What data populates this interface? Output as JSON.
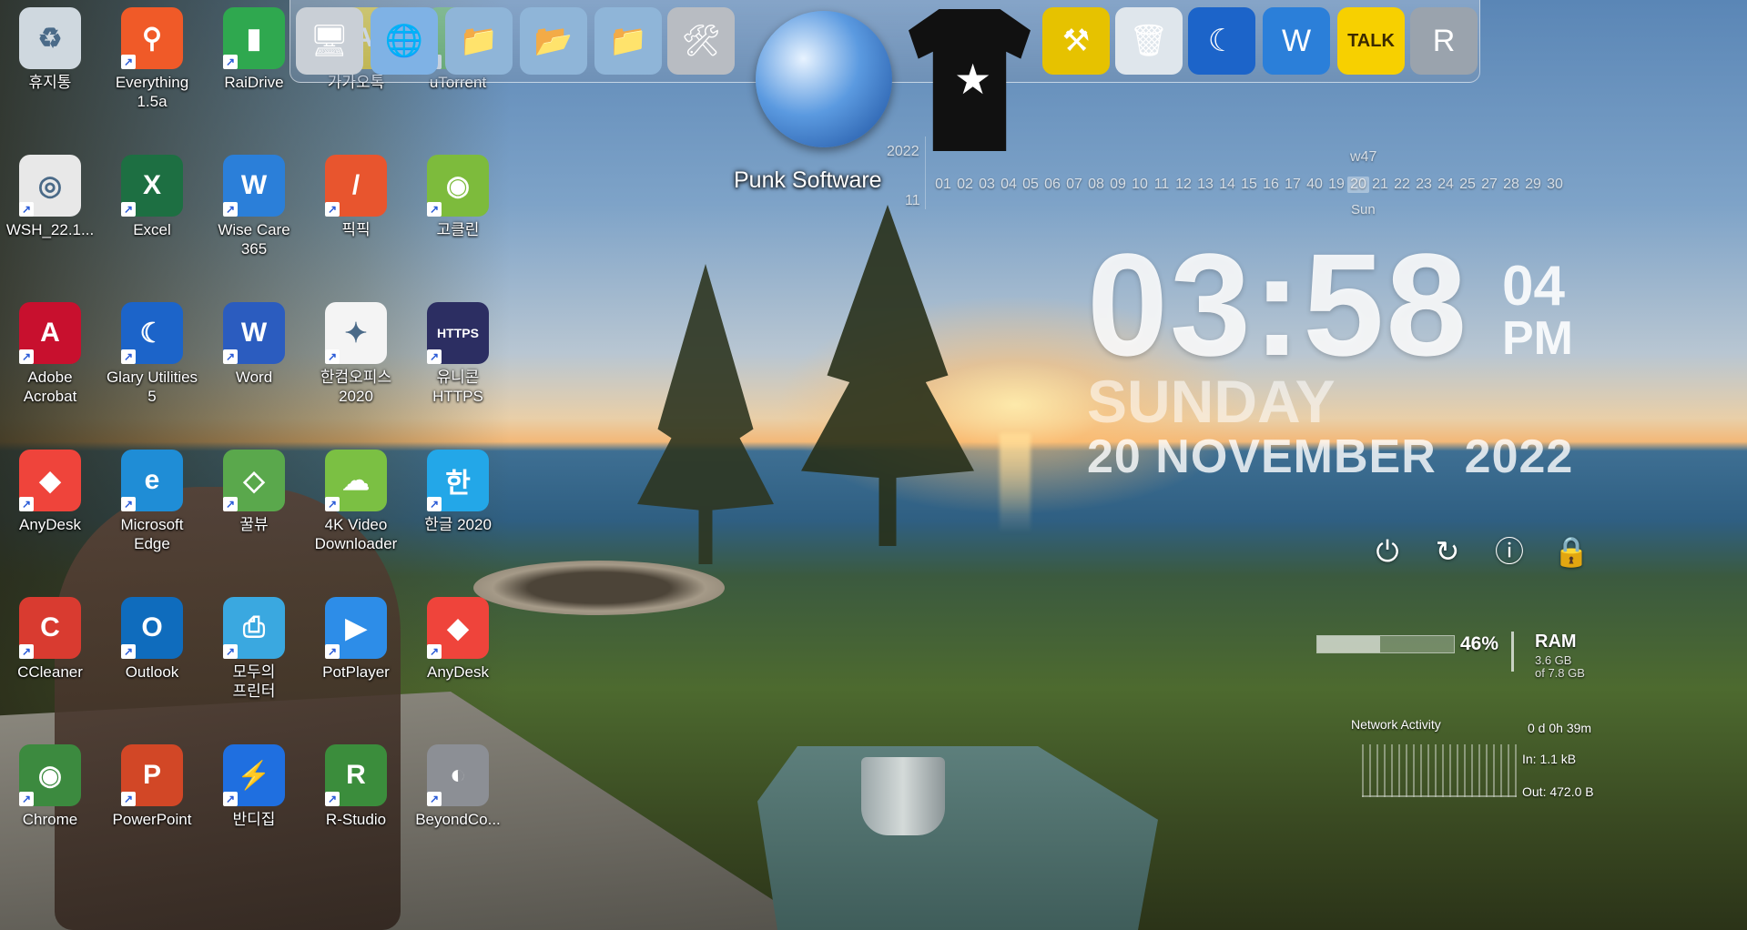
{
  "desktop_icons": [
    {
      "label": "휴지통",
      "icon": "recycle-bin-icon",
      "color": "#cfd8df"
    },
    {
      "label": "Everything\n1.5a",
      "icon": "search-magnifier-icon",
      "color": "#f05a28"
    },
    {
      "label": "RaiDrive",
      "icon": "raidrive-icon",
      "color": "#2fa84f"
    },
    {
      "label": "가가오톡",
      "icon": "kakaotalk-icon",
      "color": "#f7d000"
    },
    {
      "label": "uTorrent",
      "icon": "utorrent-icon",
      "color": "#58b947"
    },
    {
      "label": "WSH_22.1...",
      "icon": "cd-file-icon",
      "color": "#e8e8e8"
    },
    {
      "label": "Excel",
      "icon": "excel-icon",
      "color": "#1d6f42"
    },
    {
      "label": "Wise Care\n365",
      "icon": "wise-care-icon",
      "color": "#2b7fd9"
    },
    {
      "label": "픽픽",
      "icon": "picpick-icon",
      "color": "#e8552e"
    },
    {
      "label": "고클린",
      "icon": "goclean-icon",
      "color": "#7dbb3c"
    },
    {
      "label": "Adobe\nAcrobat",
      "icon": "acrobat-icon",
      "color": "#c8102e"
    },
    {
      "label": "Glary Utilities\n5",
      "icon": "glary-icon",
      "color": "#1c64c9"
    },
    {
      "label": "Word",
      "icon": "word-icon",
      "color": "#2b5cbf"
    },
    {
      "label": "한컴오피스\n2020",
      "icon": "hancom-icon",
      "color": "#f4f4f4"
    },
    {
      "label": "유니콘\nHTTPS",
      "icon": "unicorn-https-icon",
      "color": "#2c2e62"
    },
    {
      "label": "AnyDesk",
      "icon": "anydesk-icon",
      "color": "#ef443b"
    },
    {
      "label": "Microsoft\nEdge",
      "icon": "edge-icon",
      "color": "#1f8dd6"
    },
    {
      "label": "꿀뷰",
      "icon": "honeyview-icon",
      "color": "#5aa84c"
    },
    {
      "label": "4K Video\nDownloader",
      "icon": "4k-video-downloader-icon",
      "color": "#7bc043"
    },
    {
      "label": "한글 2020",
      "icon": "hangul-icon",
      "color": "#23a7e8"
    },
    {
      "label": "CCleaner",
      "icon": "ccleaner-icon",
      "color": "#d93b30"
    },
    {
      "label": "Outlook",
      "icon": "outlook-icon",
      "color": "#0f6cbd"
    },
    {
      "label": "모두의\n프린터",
      "icon": "printer-icon",
      "color": "#3aa8e0"
    },
    {
      "label": "PotPlayer",
      "icon": "potplayer-icon",
      "color": "#2d8de8"
    },
    {
      "label": "AnyDesk",
      "icon": "anydesk-icon",
      "color": "#ef443b"
    },
    {
      "label": "Chrome",
      "icon": "chrome-icon",
      "color": "#3c8a3f"
    },
    {
      "label": "PowerPoint",
      "icon": "powerpoint-icon",
      "color": "#d24726"
    },
    {
      "label": "반디집",
      "icon": "bandizip-icon",
      "color": "#1f6fe0"
    },
    {
      "label": "R-Studio",
      "icon": "r-studio-icon",
      "color": "#3b8d3c"
    },
    {
      "label": "BeyondCo...",
      "icon": "beyond-compare-icon",
      "color": "#8c8f95"
    }
  ],
  "dock": {
    "items": [
      {
        "name": "computer-icon",
        "glyph": "🖥",
        "color": "#c9cfd6"
      },
      {
        "name": "network-globe-icon",
        "glyph": "🌐",
        "color": "#7fb2e5"
      },
      {
        "name": "folder-icon",
        "glyph": "📁",
        "color": "#8fb5d8"
      },
      {
        "name": "network-folder-icon",
        "glyph": "📂",
        "color": "#8fb5d8"
      },
      {
        "name": "folder-icon-2",
        "glyph": "📁",
        "color": "#8fb5d8"
      },
      {
        "name": "tools-icon",
        "glyph": "🛠",
        "color": "#b8bcc2"
      },
      {
        "name": "hammer-tools-icon",
        "glyph": "⚒",
        "color": "#e6c200"
      },
      {
        "name": "recycle-bin-icon",
        "glyph": "🗑",
        "color": "#dfe6ec"
      },
      {
        "name": "glary-icon",
        "glyph": "☾",
        "color": "#1c64c9"
      },
      {
        "name": "wise-care-icon",
        "glyph": "W",
        "color": "#2b7fd9"
      },
      {
        "name": "kakaotalk-icon",
        "glyph": "TALK",
        "color": "#f7d000"
      },
      {
        "name": "r-studio-icon",
        "glyph": "R",
        "color": "#9aa3ad"
      }
    ]
  },
  "punk_software": "Punk Software",
  "calendar": {
    "year": "2022",
    "month": "11",
    "week": "w47",
    "day_abbr": "Sun",
    "days": [
      "01",
      "02",
      "03",
      "04",
      "05",
      "06",
      "07",
      "08",
      "09",
      "10",
      "11",
      "12",
      "13",
      "14",
      "15",
      "16",
      "17",
      "40",
      "19",
      "20",
      "21",
      "22",
      "23",
      "24",
      "25",
      "27",
      "28",
      "29",
      "30"
    ],
    "today": "20"
  },
  "clock": {
    "time": "03:58",
    "seconds": "04",
    "ampm": "PM",
    "day": "SUNDAY",
    "date": "20 NOVEMBER  2022"
  },
  "system_buttons": [
    {
      "name": "power-icon",
      "glyph": "⏻"
    },
    {
      "name": "restart-icon",
      "glyph": "↻"
    },
    {
      "name": "logoff-icon",
      "glyph": "ⓘ"
    },
    {
      "name": "lock-icon",
      "glyph": "🔒"
    }
  ],
  "ram": {
    "percent_value": 0.46,
    "percent_text": "46%",
    "label": "RAM",
    "used": "3.6 GB",
    "total": "of 7.8 GB"
  },
  "network": {
    "title": "Network Activity",
    "uptime": "0 d 0h 39m",
    "in": "In: 1.1 kB",
    "out": "Out: 472.0 B"
  }
}
